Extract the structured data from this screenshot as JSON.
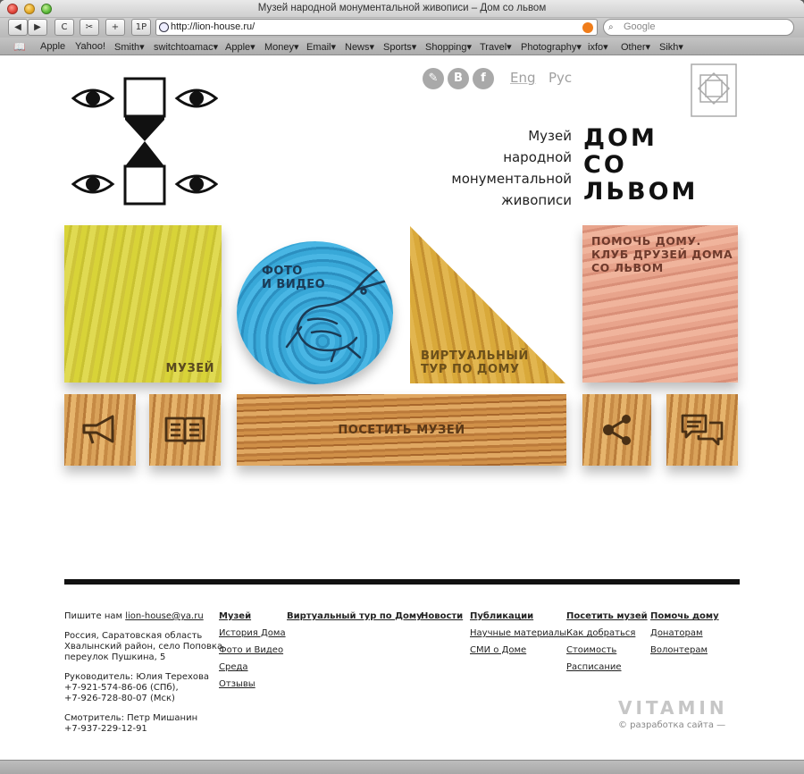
{
  "window": {
    "title": "Музей народной монументальной живописи – Дом со львом"
  },
  "toolbar": {
    "back_label": "◀",
    "forward_label": "▶",
    "reload_label": "C",
    "snip_label": "✂",
    "add_label": "+",
    "onepw_label": "1P",
    "url": "http://lion-house.ru/",
    "search_placeholder": "Google"
  },
  "bookmarks": [
    {
      "label": "Apple"
    },
    {
      "label": "Yahoo!"
    },
    {
      "label": "Smith▾"
    },
    {
      "label": "switchtoamac▾"
    },
    {
      "label": "Apple▾"
    },
    {
      "label": "Money▾"
    },
    {
      "label": "Email▾"
    },
    {
      "label": "News▾"
    },
    {
      "label": "Sports▾"
    },
    {
      "label": "Shopping▾"
    },
    {
      "label": "Travel▾"
    },
    {
      "label": "Photography▾"
    },
    {
      "label": "ixfo▾"
    },
    {
      "label": "Other▾"
    },
    {
      "label": "Sikh▾"
    }
  ],
  "header": {
    "social": {
      "lj": "✎",
      "vk": "B",
      "fb": "f"
    },
    "lang_en": "Eng",
    "lang_ru": "Рус",
    "subtitle_lines": [
      "Музей",
      "народной",
      "монументальной",
      "живописи"
    ],
    "title_lines": [
      "ДОМ",
      "СО",
      "ЛЬВОМ"
    ]
  },
  "blocks": {
    "museum": "МУЗЕЙ",
    "photo_video": [
      "ФОТО",
      "И ВИДЕО"
    ],
    "virtual_tour": [
      "ВИРТУАЛЬНЫЙ",
      "ТУР ПО ДОМУ"
    ],
    "help": [
      "ПОМОЧЬ ДОМУ.",
      "КЛУБ ДРУЗЕЙ ДОМА",
      "СО ЛЬВОМ"
    ],
    "visit": "ПОСЕТИТЬ МУЗЕЙ"
  },
  "footer": {
    "write_us": "Пишите нам",
    "email": "lion-house@ya.ru",
    "address": [
      "Россия, Саратовская область",
      "Хвалынский район, село Поповка",
      "переулок Пушкина, 5"
    ],
    "director": [
      "Руководитель: Юлия Терехова",
      "+7-921-574-86-06 (СПб),",
      "+7-926-728-80-07 (Мск)"
    ],
    "keeper": [
      "Смотритель: Петр Мишанин",
      "+7-937-229-12-91"
    ],
    "col_museum": {
      "head": "Музей",
      "items": [
        "История Дома",
        "Фото и Видео",
        "Среда",
        "Отзывы"
      ]
    },
    "col_tour": {
      "head": "Виртуальный тур по Дому"
    },
    "col_news": {
      "head": "Новости"
    },
    "col_pubs": {
      "head": "Публикации",
      "items": [
        "Научные материалы",
        "СМИ о Доме"
      ]
    },
    "col_visit": {
      "head": "Посетить музей",
      "items": [
        "Как добраться",
        "Стоимость",
        "Расписание"
      ]
    },
    "col_help": {
      "head": "Помочь дому",
      "items": [
        "Донаторам",
        "Волонтерам"
      ]
    },
    "vitamin": "VITAMIN",
    "dev_credit": "© разработка сайта —"
  }
}
